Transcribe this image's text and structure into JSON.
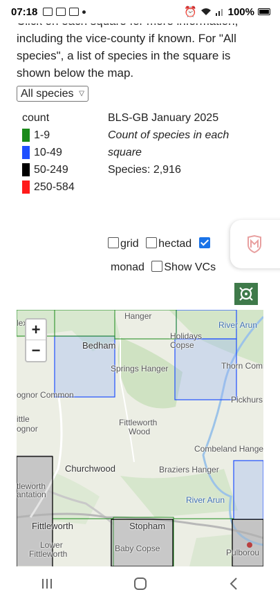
{
  "status_bar": {
    "time": "07:18",
    "battery": "100%"
  },
  "intro": {
    "line1": "Click on each square for more information,",
    "line2": "including the vice-county if known. For \"All",
    "line3": "species\", a list of species in the square is",
    "line4": "shown below the map."
  },
  "species_select": {
    "value": "All species"
  },
  "legend": {
    "header": "count",
    "items": [
      {
        "label": "1-9",
        "color": "#1a8a1a"
      },
      {
        "label": "10-49",
        "color": "#1f4fff"
      },
      {
        "label": "50-249",
        "color": "#000000"
      },
      {
        "label": "250-584",
        "color": "#ff1a1a"
      }
    ]
  },
  "info": {
    "dataset": "BLS-GB January 2025",
    "description_line1": "Count of species in each",
    "description_line2": "square",
    "species_count": "Species: 2,916"
  },
  "options": {
    "grid": "grid",
    "hectad": "hectad",
    "monad": "monad",
    "show_vcs": "Show VCs"
  },
  "map": {
    "zoom_in": "+",
    "zoom_out": "−",
    "labels": {
      "hanger_top": "Hanger",
      "park": "lex Park",
      "river_arun_top": "River Arun",
      "holidays_copse": "Holidays Copse",
      "bedham": "Bedham",
      "springs_hanger": "Springs Hanger",
      "thorn_comm": "Thorn Comm",
      "bognor_common": "ognor Common",
      "pickhurst": "Pickhurs",
      "little_bognor_1": "ittle",
      "little_bognor_2": "ognor",
      "fittleworth_wood_1": "Fittleworth",
      "fittleworth_wood_2": "Wood",
      "combeland_hanger": "Combeland Hanger",
      "churchwood": "Churchwood",
      "braziers_hanger": "Braziers Hanger",
      "plantation_1": "tleworth",
      "plantation_2": "antation",
      "river_arun_mid": "River Arun",
      "fittleworth": "Fittleworth",
      "stopham": "Stopham",
      "lower_fittleworth_1": "Lower",
      "lower_fittleworth_2": "Fittleworth",
      "baby_copse": "Baby Copse",
      "pulborough": "Pulborou"
    }
  }
}
